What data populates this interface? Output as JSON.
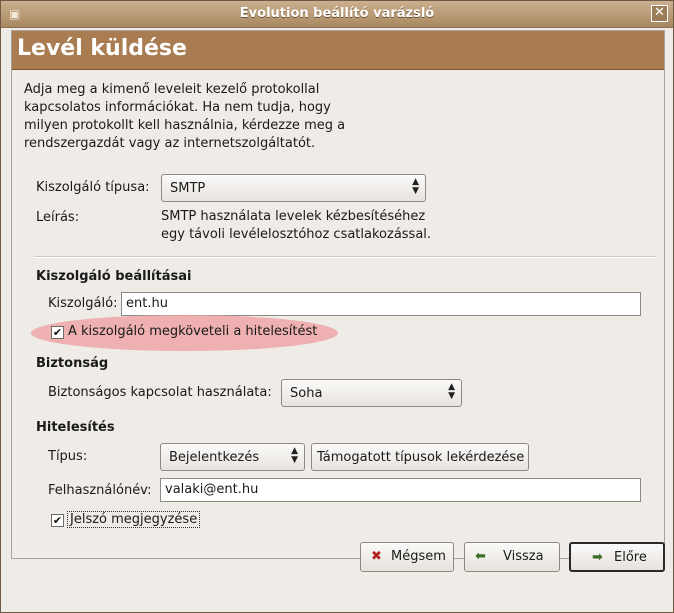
{
  "window": {
    "title": "Evolution beállító varázsló",
    "close_glyph": "✕"
  },
  "banner": {
    "title": "Levél küldése"
  },
  "description": "Adja meg a kimenő leveleit kezelő protokollal kapcsolatos információkat. Ha nem tudja, hogy milyen protokollt kell használnia, kérdezze meg a rendszergazdát vagy az internetszolgáltatót.",
  "server_type": {
    "label": "Kiszolgáló típusa:",
    "value": "SMTP"
  },
  "info": {
    "label": "Leírás:",
    "value": "SMTP használata levelek kézbesítéséhez egy távoli levélelosztóhoz csatlakozással."
  },
  "server_settings": {
    "heading": "Kiszolgáló beállításai",
    "server_label": "Kiszolgáló:",
    "server_value": "ent.hu",
    "auth_required_label": "A kiszolgáló megköveteli a hitelesítést",
    "auth_required_checked": true
  },
  "security": {
    "heading": "Biztonság",
    "secure_label": "Biztonságos kapcsolat használata:",
    "secure_value": "Soha"
  },
  "authentication": {
    "heading": "Hitelesítés",
    "type_label": "Típus:",
    "type_value": "Bejelentkezés",
    "check_types_button": "Támogatott típusok lekérdezése",
    "username_label": "Felhasználónév:",
    "username_value": "valaki@ent.hu",
    "remember_password_label": "Jelszó megjegyzése",
    "remember_password_checked": true
  },
  "buttons": {
    "cancel": "Mégsem",
    "back": "Vissza",
    "forward": "Előre"
  }
}
